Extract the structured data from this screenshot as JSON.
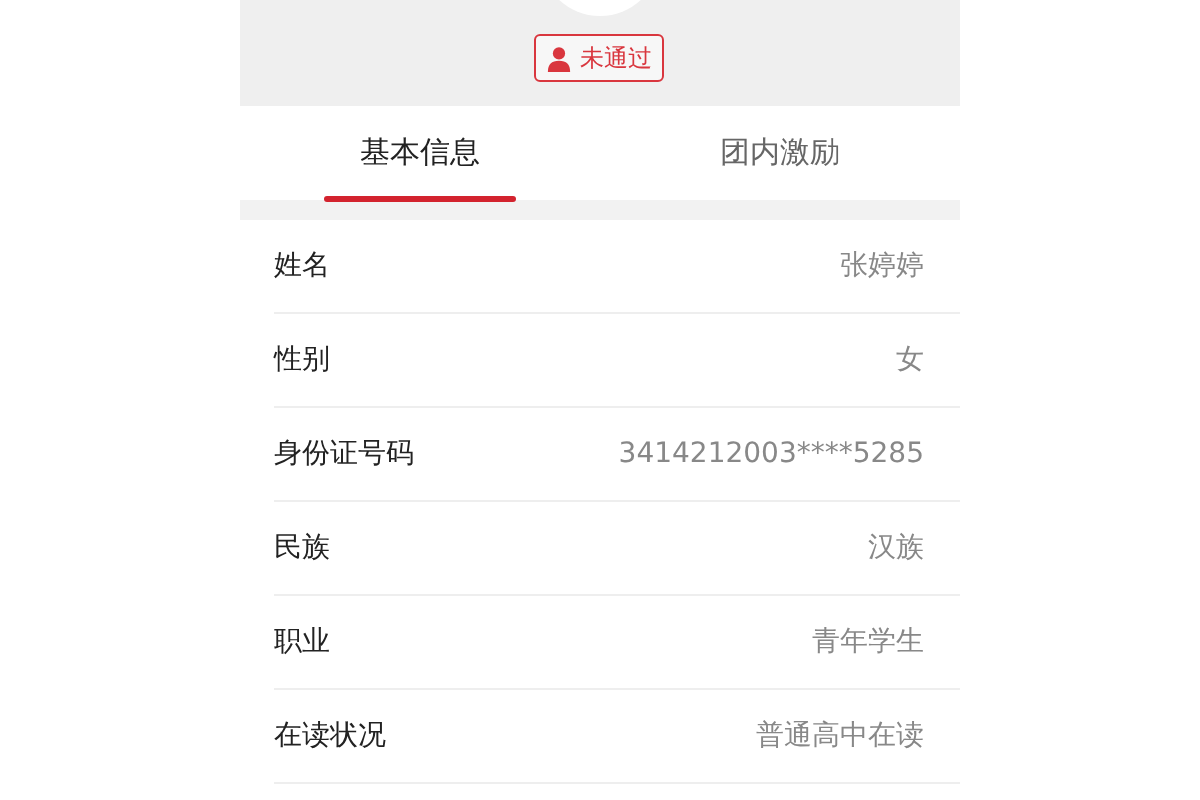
{
  "status_badge": {
    "label": "未通过"
  },
  "tabs": [
    {
      "label": "基本信息",
      "selected": true
    },
    {
      "label": "团内激励",
      "selected": false
    }
  ],
  "fields": [
    {
      "label": "姓名",
      "value": "张婷婷"
    },
    {
      "label": "性别",
      "value": "女"
    },
    {
      "label": "身份证号码",
      "value": "3414212003****5285"
    },
    {
      "label": "民族",
      "value": "汉族"
    },
    {
      "label": "职业",
      "value": "青年学生"
    },
    {
      "label": "在读状况",
      "value": "普通高中在读"
    }
  ]
}
